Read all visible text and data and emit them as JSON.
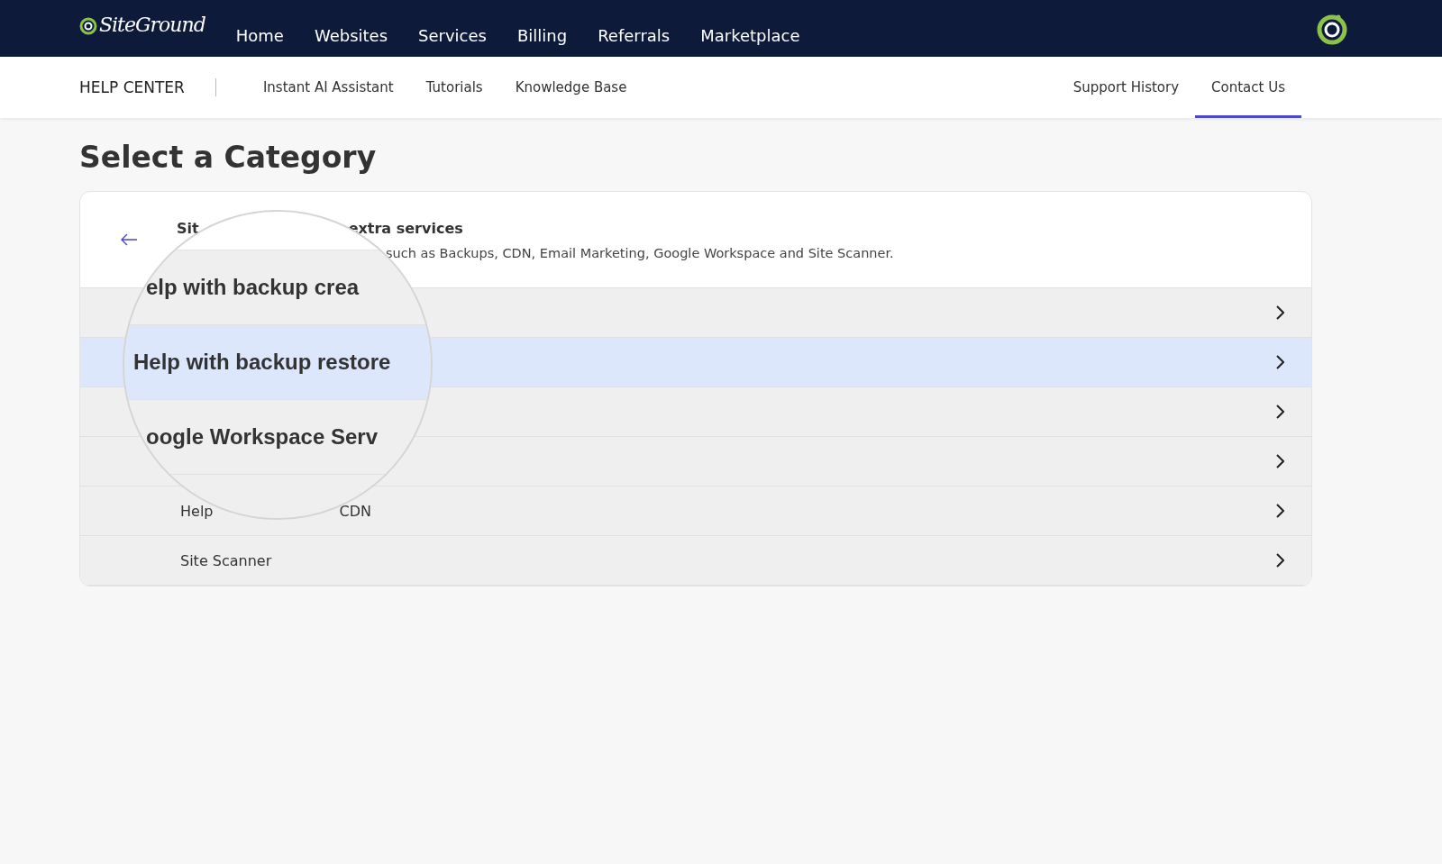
{
  "top_nav": {
    "logo": "SiteGround",
    "items": [
      {
        "label": "Home"
      },
      {
        "label": "Websites"
      },
      {
        "label": "Services"
      },
      {
        "label": "Billing"
      },
      {
        "label": "Referrals"
      },
      {
        "label": "Marketplace"
      }
    ]
  },
  "sub_nav": {
    "title": "HELP CENTER",
    "left_items": [
      {
        "label": "Instant AI Assistant",
        "selected": false
      },
      {
        "label": "Tutorials",
        "selected": false
      },
      {
        "label": "Knowledge Base",
        "selected": false
      }
    ],
    "right_items": [
      {
        "label": "Support History",
        "selected": false
      },
      {
        "label": "Contact Us",
        "selected": true
      }
    ]
  },
  "page_title": "Select a Category",
  "category": {
    "title_parts": [
      "Sit",
      "extra services"
    ],
    "description": "such as Backups, CDN, Email Marketing, Google Workspace and Site Scanner."
  },
  "options": [
    {
      "selected": false
    },
    {
      "selected": true
    },
    {
      "selected": false
    },
    {
      "selected": false
    },
    {
      "label_parts": [
        "Help",
        "CDN"
      ],
      "selected": false
    },
    {
      "label_parts": [
        "Site Scanner"
      ],
      "selected": false
    }
  ],
  "magnifier": {
    "rows": [
      {
        "label": "elp with backup crea",
        "selected": false
      },
      {
        "label": "Help with backup restore",
        "selected": true
      },
      {
        "label": "oogle Workspace Serv",
        "selected": false
      }
    ]
  }
}
